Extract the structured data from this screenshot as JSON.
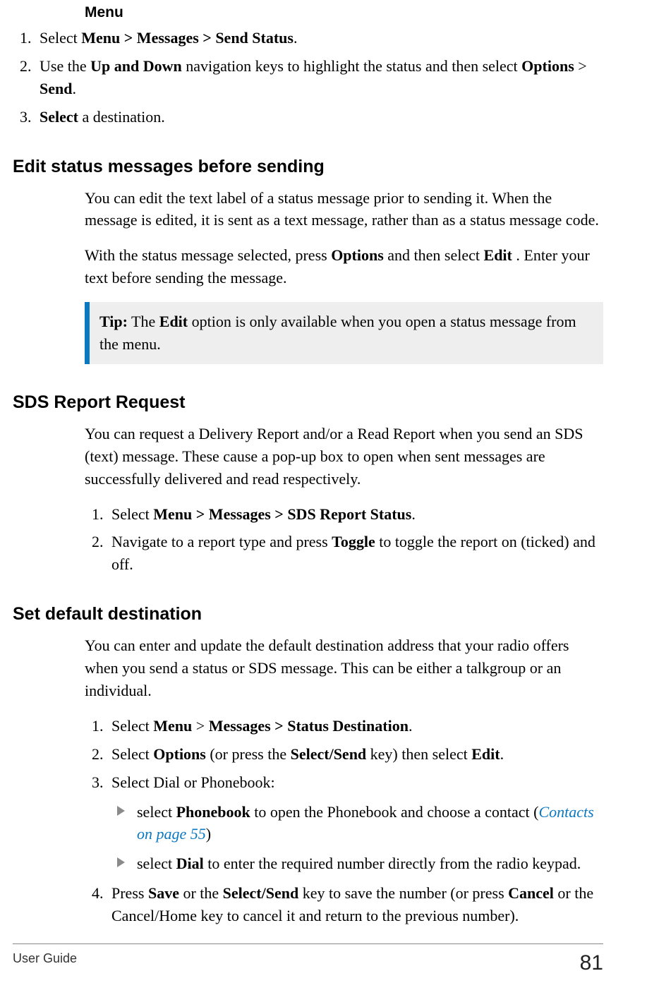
{
  "top": {
    "menu_word": "Menu",
    "steps": [
      {
        "pre": "Select ",
        "b1": "Menu > Messages > Send Status",
        "post": "."
      },
      {
        "pre": "Use the ",
        "b1": "Up and Down",
        "mid1": " navigation keys to highlight the status and then select ",
        "b2": "Options",
        "mid2": " > ",
        "b3": "Send",
        "post": "."
      },
      {
        "b1": "Select",
        "post": " a destination."
      }
    ]
  },
  "edit": {
    "heading": "Edit status messages before sending",
    "p1": "You can edit the text label of a status message prior to sending it. When the message is edited, it is sent as a text message, rather than as a status message code.",
    "p2a": "With the status message selected, press ",
    "p2b": "Options",
    "p2c": " and then select ",
    "p2d": "Edit",
    "p2e": " . Enter your text before sending the message.",
    "tip_label": "Tip:",
    "tip_a": "  The ",
    "tip_b": "Edit",
    "tip_c": " option is only available when you open a status message from the menu."
  },
  "sds": {
    "heading": "SDS Report Request",
    "p1": "You can request a Delivery Report and/or a Read Report when you send an SDS (text) message. These cause a pop-up box to open when sent messages are successfully delivered and read respectively.",
    "step1_pre": "Select ",
    "step1_b": "Menu > Messages > SDS Report Status",
    "step1_post": ".",
    "step2_pre": "Navigate to a report type and press ",
    "step2_b": "Toggle",
    "step2_post": " to toggle the report on (ticked) and off."
  },
  "dest": {
    "heading": "Set default destination",
    "p1": "You can enter and update the default destination address that your radio offers when you send a status or SDS message. This can be either a talkgroup or an individual.",
    "s1_a": "Select ",
    "s1_b": "Menu",
    "s1_c": " > ",
    "s1_d": "Messages > Status Destination",
    "s1_e": ".",
    "s2_a": "Select ",
    "s2_b": "Options",
    "s2_c": " (or press the ",
    "s2_d": "Select/Send",
    "s2_e": " key) then select ",
    "s2_f": "Edit",
    "s2_g": ".",
    "s3": "Select Dial or Phonebook:",
    "b1_a": "select ",
    "b1_b": "Phonebook",
    "b1_c": " to open the Phonebook and choose a contact (",
    "b1_link": "Contacts on page 55",
    "b1_d": ")",
    "b2_a": "select ",
    "b2_b": "Dial",
    "b2_c": " to enter the required number directly from the radio keypad.",
    "s4_a": "Press ",
    "s4_b": "Save",
    "s4_c": " or the ",
    "s4_d": "Select/Send",
    "s4_e": " key to save the number (or press ",
    "s4_f": "Cancel",
    "s4_g": " or the Cancel/Home key to cancel it and return to the previous number)."
  },
  "footer": {
    "title": "User Guide",
    "page": "81"
  }
}
